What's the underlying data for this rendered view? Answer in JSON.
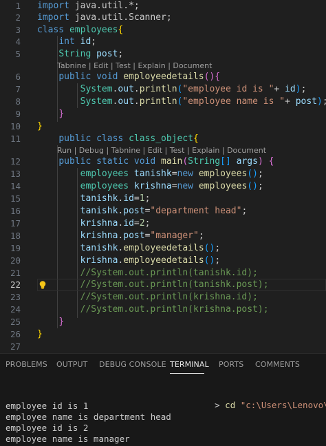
{
  "editor": {
    "lines": [
      {
        "n": "1",
        "t": [
          [
            "kw",
            "import "
          ],
          [
            "",
            "java.util.*;"
          ]
        ]
      },
      {
        "n": "2",
        "t": [
          [
            "kw",
            "import "
          ],
          [
            "",
            "java.util.Scanner;"
          ]
        ]
      },
      {
        "n": "3",
        "t": [
          [
            "kw",
            "class "
          ],
          [
            "ty",
            "employees"
          ],
          [
            "b1",
            "{"
          ]
        ]
      },
      {
        "n": "4",
        "t": [
          [
            "",
            "    "
          ],
          [
            "kw",
            "int "
          ],
          [
            "va",
            "id"
          ],
          [
            "",
            ";"
          ]
        ]
      },
      {
        "n": "5",
        "t": [
          [
            "",
            "    "
          ],
          [
            "ty",
            "String "
          ],
          [
            "va",
            "post"
          ],
          [
            "",
            ";"
          ]
        ]
      },
      {
        "n": "6",
        "t": [
          [
            "",
            "    "
          ],
          [
            "kw",
            "public void "
          ],
          [
            "fn",
            "employeedetails"
          ],
          [
            "b2",
            "()"
          ],
          [
            "b2",
            "{"
          ]
        ]
      },
      {
        "n": "7",
        "t": [
          [
            "",
            "        "
          ],
          [
            "ty",
            "System"
          ],
          [
            "",
            "."
          ],
          [
            "va",
            "out"
          ],
          [
            "",
            "."
          ],
          [
            "fn",
            "println"
          ],
          [
            "b3",
            "("
          ],
          [
            "st",
            "\"employee id is \""
          ],
          [
            "",
            "+ "
          ],
          [
            "va",
            "id"
          ],
          [
            "b3",
            ")"
          ],
          [
            "",
            ";"
          ]
        ]
      },
      {
        "n": "8",
        "t": [
          [
            "",
            "        "
          ],
          [
            "ty",
            "System"
          ],
          [
            "",
            "."
          ],
          [
            "va",
            "out"
          ],
          [
            "",
            "."
          ],
          [
            "fn",
            "println"
          ],
          [
            "b3",
            "("
          ],
          [
            "st",
            "\"employee name is \""
          ],
          [
            "",
            "+ "
          ],
          [
            "va",
            "post"
          ],
          [
            "b3",
            ")"
          ],
          [
            "",
            ";"
          ]
        ]
      },
      {
        "n": "9",
        "t": [
          [
            "",
            "    "
          ],
          [
            "b2",
            "}"
          ]
        ]
      },
      {
        "n": "10",
        "t": [
          [
            "b1",
            "}"
          ]
        ]
      },
      {
        "n": "11",
        "t": [
          [
            "",
            "    "
          ],
          [
            "kw",
            "public class "
          ],
          [
            "ty",
            "class_object"
          ],
          [
            "b1",
            "{"
          ]
        ]
      },
      {
        "n": "12",
        "t": [
          [
            "",
            "    "
          ],
          [
            "kw",
            "public static void "
          ],
          [
            "fn",
            "main"
          ],
          [
            "b2",
            "("
          ],
          [
            "ty",
            "String"
          ],
          [
            "b3",
            "[]"
          ],
          [
            "va",
            " args"
          ],
          [
            "b2",
            ")"
          ],
          [
            "",
            ""
          ],
          [
            "b2",
            " {"
          ]
        ]
      },
      {
        "n": "13",
        "t": [
          [
            "",
            "        "
          ],
          [
            "ty",
            "employees "
          ],
          [
            "va",
            "tanishk"
          ],
          [
            "",
            "="
          ],
          [
            "kw",
            "new "
          ],
          [
            "fn",
            "employees"
          ],
          [
            "b3",
            "()"
          ],
          [
            "",
            ";"
          ]
        ]
      },
      {
        "n": "14",
        "t": [
          [
            "",
            "        "
          ],
          [
            "ty",
            "employees "
          ],
          [
            "va",
            "krishna"
          ],
          [
            "",
            "="
          ],
          [
            "kw",
            "new "
          ],
          [
            "fn",
            "employees"
          ],
          [
            "b3",
            "()"
          ],
          [
            "",
            ";"
          ]
        ]
      },
      {
        "n": "15",
        "t": [
          [
            "",
            "        "
          ],
          [
            "va",
            "tanishk"
          ],
          [
            "",
            "."
          ],
          [
            "va",
            "id"
          ],
          [
            "",
            "="
          ],
          [
            "nu",
            "1"
          ],
          [
            "",
            ";"
          ]
        ]
      },
      {
        "n": "16",
        "t": [
          [
            "",
            "        "
          ],
          [
            "va",
            "tanishk"
          ],
          [
            "",
            "."
          ],
          [
            "va",
            "post"
          ],
          [
            "",
            "="
          ],
          [
            "st",
            "\"department head\""
          ],
          [
            "",
            ";"
          ]
        ]
      },
      {
        "n": "17",
        "t": [
          [
            "",
            "        "
          ],
          [
            "va",
            "krishna"
          ],
          [
            "",
            "."
          ],
          [
            "va",
            "id"
          ],
          [
            "",
            "="
          ],
          [
            "nu",
            "2"
          ],
          [
            "",
            ";"
          ]
        ]
      },
      {
        "n": "18",
        "t": [
          [
            "",
            "        "
          ],
          [
            "va",
            "krishna"
          ],
          [
            "",
            "."
          ],
          [
            "va",
            "post"
          ],
          [
            "",
            "="
          ],
          [
            "st",
            "\"manager\""
          ],
          [
            "",
            ";"
          ]
        ]
      },
      {
        "n": "19",
        "t": [
          [
            "",
            "        "
          ],
          [
            "va",
            "tanishk"
          ],
          [
            "",
            "."
          ],
          [
            "fn",
            "employeedetails"
          ],
          [
            "b3",
            "()"
          ],
          [
            "",
            ";"
          ]
        ]
      },
      {
        "n": "20",
        "t": [
          [
            "",
            "        "
          ],
          [
            "va",
            "krishna"
          ],
          [
            "",
            "."
          ],
          [
            "fn",
            "employeedetails"
          ],
          [
            "b3",
            "()"
          ],
          [
            "",
            ";"
          ]
        ]
      },
      {
        "n": "21",
        "t": [
          [
            "",
            "        "
          ],
          [
            "cm",
            "//System.out.println(tanishk.id);"
          ]
        ]
      },
      {
        "n": "22",
        "t": [
          [
            "",
            "        "
          ],
          [
            "cm",
            "//System.out.println(tanishk.post);"
          ]
        ]
      },
      {
        "n": "23",
        "t": [
          [
            "",
            "        "
          ],
          [
            "cm",
            "//System.out.println(krishna.id);"
          ]
        ]
      },
      {
        "n": "24",
        "t": [
          [
            "",
            "        "
          ],
          [
            "cm",
            "//System.out.println(krishna.post);"
          ]
        ]
      },
      {
        "n": "25",
        "t": [
          [
            "",
            "    "
          ],
          [
            "b2",
            "}"
          ]
        ]
      },
      {
        "n": "26",
        "t": [
          [
            "b1",
            "}"
          ]
        ]
      },
      {
        "n": "27",
        "t": []
      }
    ],
    "codelens_1": "Tabnine | Edit | Test | Explain | Document",
    "codelens_2": "Run | Debug | Tabnine | Edit | Test | Explain | Document",
    "active_line": "22",
    "lightbulb_icon": "lightbulb-icon"
  },
  "panel": {
    "tabs": [
      "PROBLEMS",
      "OUTPUT",
      "DEBUG CONSOLE",
      "TERMINAL",
      "PORTS",
      "COMMENTS"
    ],
    "active_tab": "TERMINAL",
    "prompt_symbol": ">",
    "prompt_command": "cd ",
    "prompt_arg": "\"c:\\Users\\Lenovo\\OneDri",
    "output": [
      "employee id is 1",
      "employee name is department head",
      "employee id is 2",
      "employee name is manager"
    ],
    "colors": {
      "prompt_symbol": "#cccccc",
      "prompt_arg": "#ce9178"
    }
  }
}
